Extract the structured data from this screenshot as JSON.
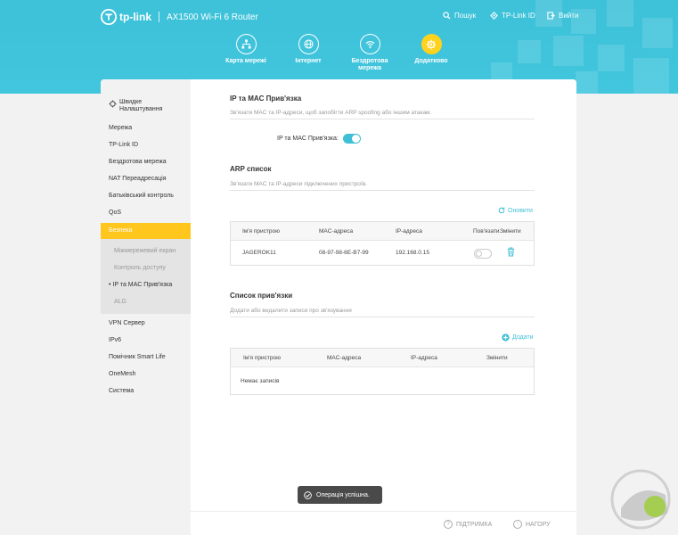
{
  "header": {
    "brand": "tp-link",
    "model": "AX1500 Wi-Fi 6 Router",
    "top_links": [
      {
        "label": "Пошук",
        "icon": "search-icon"
      },
      {
        "label": "TP-Link ID",
        "icon": "user-icon"
      },
      {
        "label": "Вийти",
        "icon": "logout-icon"
      }
    ],
    "tabs": [
      {
        "label": "Карта мережі",
        "icon": "network-map-icon"
      },
      {
        "label": "Інтернет",
        "icon": "globe-icon"
      },
      {
        "label_line1": "Бездротова",
        "label_line2": "мережа",
        "icon": "wifi-icon"
      },
      {
        "label": "Додатково",
        "icon": "gear-icon",
        "active": true
      }
    ]
  },
  "sidebar": {
    "quick_setup_line1": "Швидке",
    "quick_setup_line2": "Налаштування",
    "items": [
      "Мережа",
      "TP-Link ID",
      "Бездротова мережа",
      "NAT Переадресація",
      "Батьківський контроль",
      "QoS"
    ],
    "active": "Безпека",
    "sub_items": [
      "Міжмережевий екран",
      "Контроль доступу",
      "• IP та MAC Прив'язка",
      "ALG"
    ],
    "items_after": [
      "VPN Сервер",
      "IPv6",
      "Помічник Smart Life",
      "OneMesh",
      "Система"
    ]
  },
  "ipmac": {
    "title": "IP та MAC Прив'язка",
    "desc": "Зв'язати MAC та IP-адреси, щоб запобігти ARP spoofing або іншим атакам.",
    "toggle_label": "IP та MAC Прив'язка:",
    "enabled": true
  },
  "arp": {
    "title": "ARP список",
    "desc": "Зв'язати MAC та IP-адреси підключених пристроїв.",
    "refresh_label": "Оновити",
    "columns": [
      "Ім'я пристрою",
      "MAC-адреса",
      "IP-адреса",
      "Пов'язати",
      "Змінити"
    ],
    "rows": [
      {
        "name": "JAGEROK11",
        "mac": "08-97-98-6E-B7-99",
        "ip": "192.168.0.15",
        "bound": false
      }
    ]
  },
  "binding": {
    "title": "Список прив'язки",
    "desc": "Додати або видалити записи про зв'язування",
    "add_label": "Додати",
    "columns": [
      "Ім'я пристрою",
      "MAC-адреса",
      "IP-адреса",
      "Змінити"
    ],
    "empty": "Немає записів"
  },
  "footer": {
    "support": "ПІДТРИМКА",
    "top": "НАГОРУ"
  },
  "toast": "Операція успішна.",
  "colors": {
    "accent": "#3fbfd6",
    "active": "#ffc61e",
    "header": "#41c6de"
  }
}
